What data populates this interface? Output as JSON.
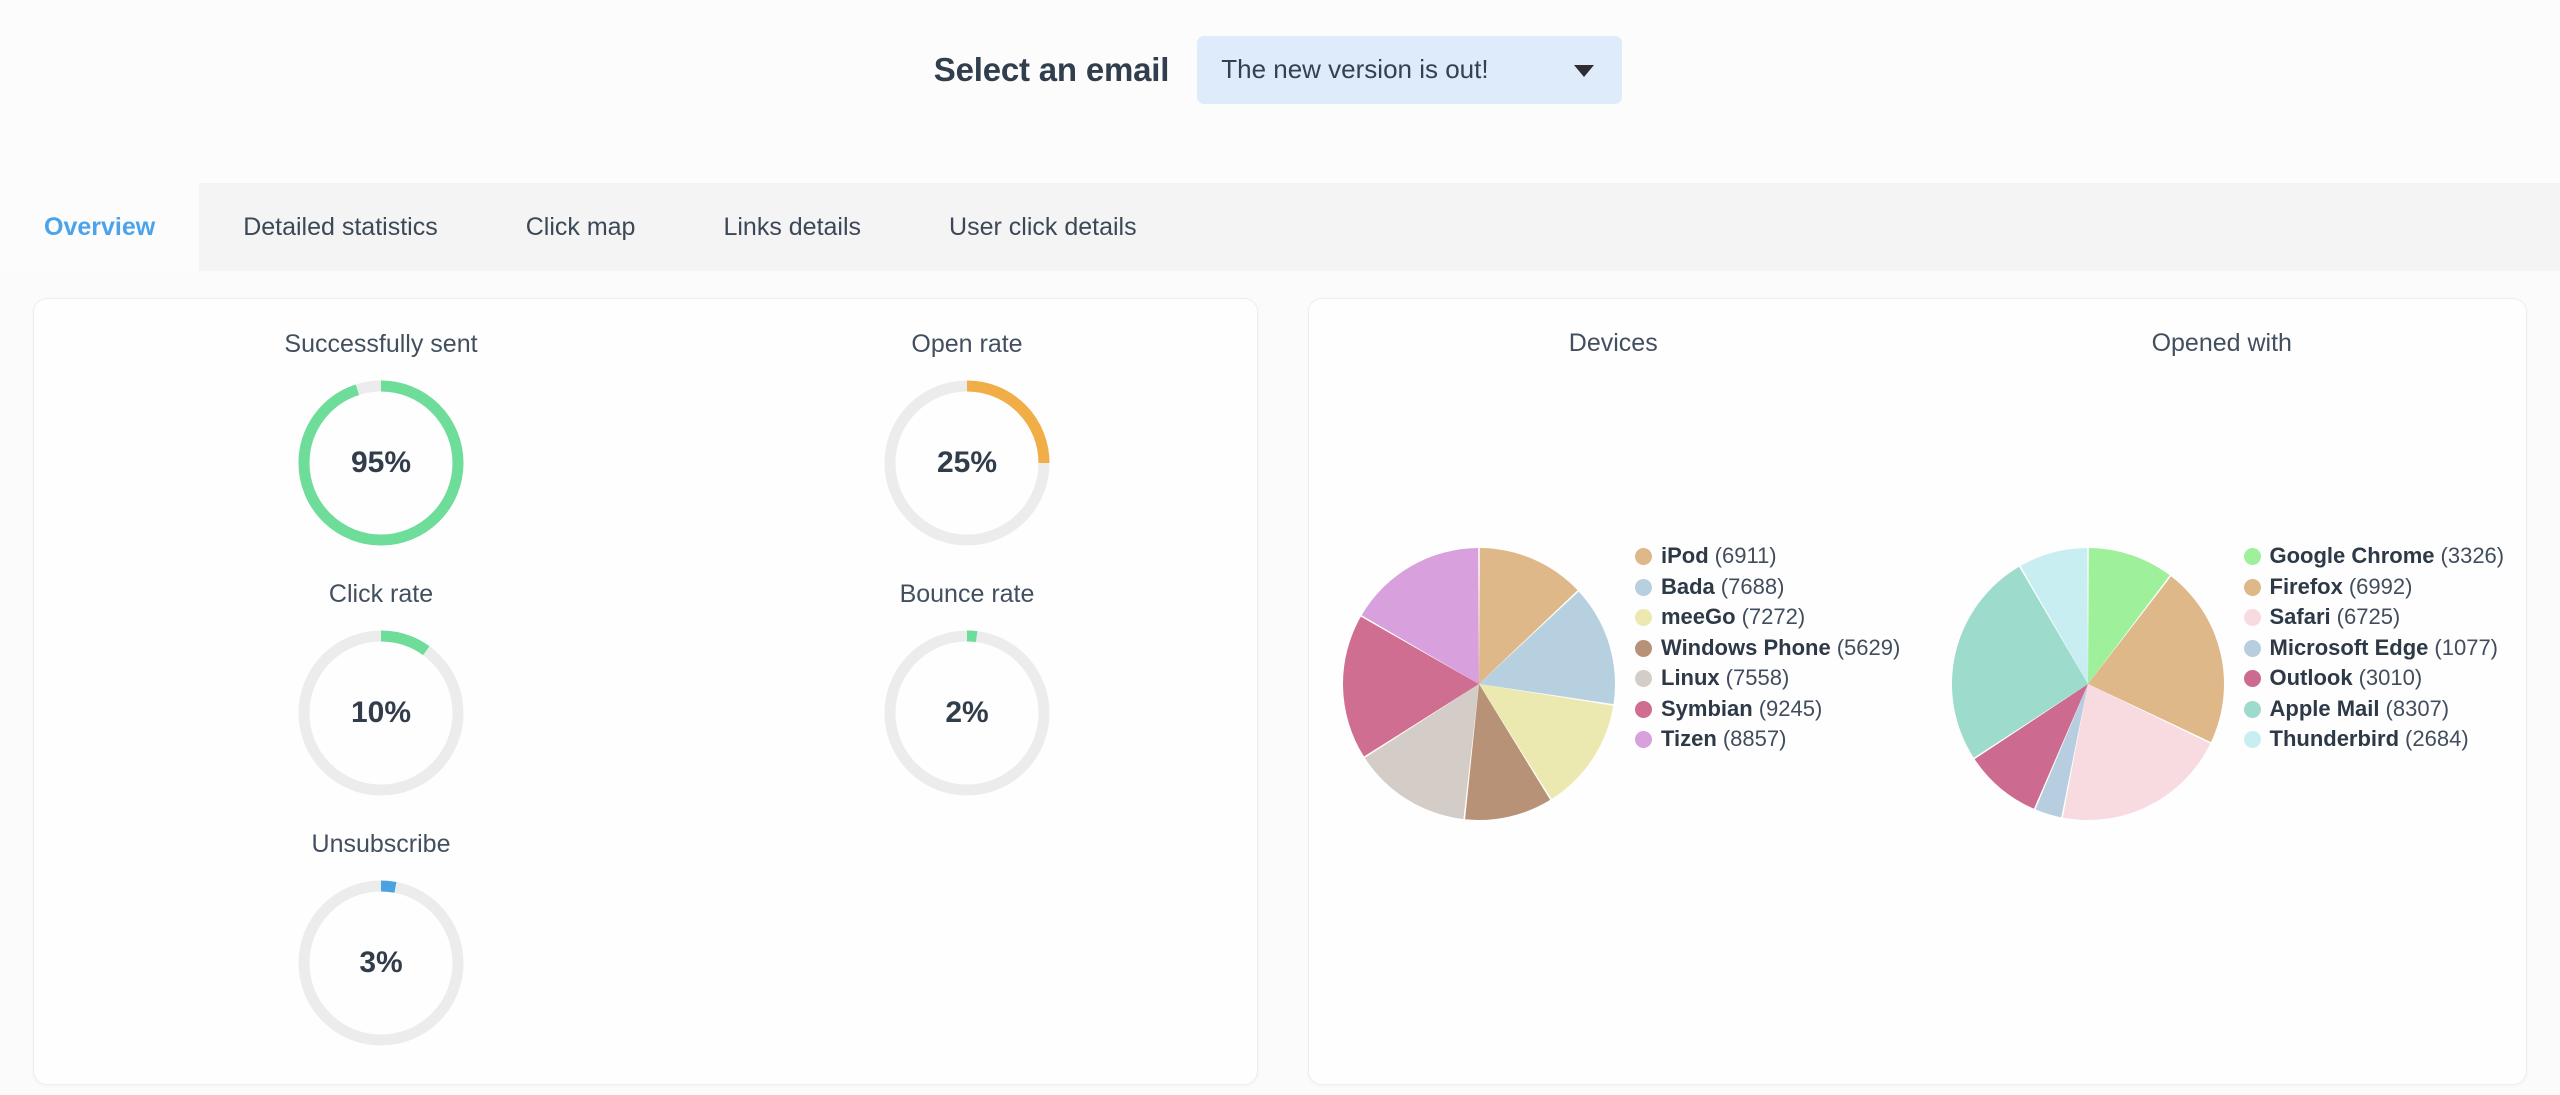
{
  "header": {
    "label": "Select an email",
    "select": {
      "value": "The new version is out!",
      "caret_icon": "chevron-down-icon",
      "bg_color": "#ddebfa"
    }
  },
  "tabs": [
    {
      "label": "Overview",
      "active": true
    },
    {
      "label": "Detailed statistics",
      "active": false
    },
    {
      "label": "Click map",
      "active": false
    },
    {
      "label": "Links details",
      "active": false
    },
    {
      "label": "User click details",
      "active": false
    }
  ],
  "gauges": [
    {
      "title": "Successfully sent",
      "value": "95%",
      "percent": 95,
      "color": "#6edd9a",
      "size": "big"
    },
    {
      "title": "Open rate",
      "value": "25%",
      "percent": 25,
      "color": "#f2ae46",
      "size": "big"
    },
    {
      "title": "Click rate",
      "value": "10%",
      "percent": 10,
      "color": "#6edd9a",
      "size": "small"
    },
    {
      "title": "Bounce rate",
      "value": "2%",
      "percent": 2,
      "color": "#6edd9a",
      "size": "small"
    },
    {
      "title": "Unsubscribe",
      "value": "3%",
      "percent": 3,
      "color": "#4aa3e0",
      "size": "small"
    }
  ],
  "track_color": "#ececed",
  "chart_data": [
    {
      "type": "pie",
      "title": "Devices",
      "legend_position": "right",
      "categories": [
        "iPod",
        "Bada",
        "meeGo",
        "Windows Phone",
        "Linux",
        "Symbian",
        "Tizen"
      ],
      "values": [
        6911,
        7688,
        7272,
        5629,
        7558,
        9245,
        8857
      ],
      "colors": [
        "#dfb88a",
        "#b7d0e0",
        "#ece9b0",
        "#b79277",
        "#d4cdc7",
        "#d06e92",
        "#d8a0dc"
      ]
    },
    {
      "type": "pie",
      "title": "Opened with",
      "legend_position": "right",
      "categories": [
        "Google Chrome",
        "Firefox",
        "Safari",
        "Microsoft Edge",
        "Outlook",
        "Apple Mail",
        "Thunderbird"
      ],
      "values": [
        3326,
        6992,
        6725,
        1077,
        3010,
        8307,
        2684
      ],
      "colors": [
        "#9ef09b",
        "#dfb88a",
        "#f7dbe0",
        "#b7cee0",
        "#cc6b8f",
        "#9ddbcd",
        "#c8eef1"
      ]
    }
  ]
}
